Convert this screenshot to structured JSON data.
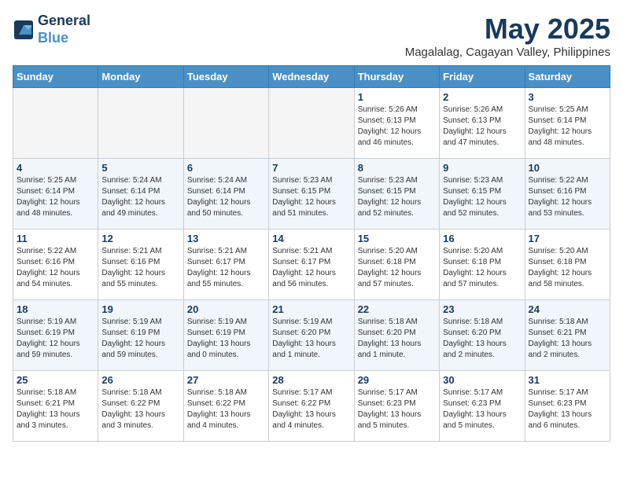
{
  "header": {
    "logo_line1": "General",
    "logo_line2": "Blue",
    "month_title": "May 2025",
    "location": "Magalalag, Cagayan Valley, Philippines"
  },
  "weekdays": [
    "Sunday",
    "Monday",
    "Tuesday",
    "Wednesday",
    "Thursday",
    "Friday",
    "Saturday"
  ],
  "weeks": [
    [
      {
        "day": "",
        "info": ""
      },
      {
        "day": "",
        "info": ""
      },
      {
        "day": "",
        "info": ""
      },
      {
        "day": "",
        "info": ""
      },
      {
        "day": "1",
        "info": "Sunrise: 5:26 AM\nSunset: 6:13 PM\nDaylight: 12 hours\nand 46 minutes."
      },
      {
        "day": "2",
        "info": "Sunrise: 5:26 AM\nSunset: 6:13 PM\nDaylight: 12 hours\nand 47 minutes."
      },
      {
        "day": "3",
        "info": "Sunrise: 5:25 AM\nSunset: 6:14 PM\nDaylight: 12 hours\nand 48 minutes."
      }
    ],
    [
      {
        "day": "4",
        "info": "Sunrise: 5:25 AM\nSunset: 6:14 PM\nDaylight: 12 hours\nand 48 minutes."
      },
      {
        "day": "5",
        "info": "Sunrise: 5:24 AM\nSunset: 6:14 PM\nDaylight: 12 hours\nand 49 minutes."
      },
      {
        "day": "6",
        "info": "Sunrise: 5:24 AM\nSunset: 6:14 PM\nDaylight: 12 hours\nand 50 minutes."
      },
      {
        "day": "7",
        "info": "Sunrise: 5:23 AM\nSunset: 6:15 PM\nDaylight: 12 hours\nand 51 minutes."
      },
      {
        "day": "8",
        "info": "Sunrise: 5:23 AM\nSunset: 6:15 PM\nDaylight: 12 hours\nand 52 minutes."
      },
      {
        "day": "9",
        "info": "Sunrise: 5:23 AM\nSunset: 6:15 PM\nDaylight: 12 hours\nand 52 minutes."
      },
      {
        "day": "10",
        "info": "Sunrise: 5:22 AM\nSunset: 6:16 PM\nDaylight: 12 hours\nand 53 minutes."
      }
    ],
    [
      {
        "day": "11",
        "info": "Sunrise: 5:22 AM\nSunset: 6:16 PM\nDaylight: 12 hours\nand 54 minutes."
      },
      {
        "day": "12",
        "info": "Sunrise: 5:21 AM\nSunset: 6:16 PM\nDaylight: 12 hours\nand 55 minutes."
      },
      {
        "day": "13",
        "info": "Sunrise: 5:21 AM\nSunset: 6:17 PM\nDaylight: 12 hours\nand 55 minutes."
      },
      {
        "day": "14",
        "info": "Sunrise: 5:21 AM\nSunset: 6:17 PM\nDaylight: 12 hours\nand 56 minutes."
      },
      {
        "day": "15",
        "info": "Sunrise: 5:20 AM\nSunset: 6:18 PM\nDaylight: 12 hours\nand 57 minutes."
      },
      {
        "day": "16",
        "info": "Sunrise: 5:20 AM\nSunset: 6:18 PM\nDaylight: 12 hours\nand 57 minutes."
      },
      {
        "day": "17",
        "info": "Sunrise: 5:20 AM\nSunset: 6:18 PM\nDaylight: 12 hours\nand 58 minutes."
      }
    ],
    [
      {
        "day": "18",
        "info": "Sunrise: 5:19 AM\nSunset: 6:19 PM\nDaylight: 12 hours\nand 59 minutes."
      },
      {
        "day": "19",
        "info": "Sunrise: 5:19 AM\nSunset: 6:19 PM\nDaylight: 12 hours\nand 59 minutes."
      },
      {
        "day": "20",
        "info": "Sunrise: 5:19 AM\nSunset: 6:19 PM\nDaylight: 13 hours\nand 0 minutes."
      },
      {
        "day": "21",
        "info": "Sunrise: 5:19 AM\nSunset: 6:20 PM\nDaylight: 13 hours\nand 1 minute."
      },
      {
        "day": "22",
        "info": "Sunrise: 5:18 AM\nSunset: 6:20 PM\nDaylight: 13 hours\nand 1 minute."
      },
      {
        "day": "23",
        "info": "Sunrise: 5:18 AM\nSunset: 6:20 PM\nDaylight: 13 hours\nand 2 minutes."
      },
      {
        "day": "24",
        "info": "Sunrise: 5:18 AM\nSunset: 6:21 PM\nDaylight: 13 hours\nand 2 minutes."
      }
    ],
    [
      {
        "day": "25",
        "info": "Sunrise: 5:18 AM\nSunset: 6:21 PM\nDaylight: 13 hours\nand 3 minutes."
      },
      {
        "day": "26",
        "info": "Sunrise: 5:18 AM\nSunset: 6:22 PM\nDaylight: 13 hours\nand 3 minutes."
      },
      {
        "day": "27",
        "info": "Sunrise: 5:18 AM\nSunset: 6:22 PM\nDaylight: 13 hours\nand 4 minutes."
      },
      {
        "day": "28",
        "info": "Sunrise: 5:17 AM\nSunset: 6:22 PM\nDaylight: 13 hours\nand 4 minutes."
      },
      {
        "day": "29",
        "info": "Sunrise: 5:17 AM\nSunset: 6:23 PM\nDaylight: 13 hours\nand 5 minutes."
      },
      {
        "day": "30",
        "info": "Sunrise: 5:17 AM\nSunset: 6:23 PM\nDaylight: 13 hours\nand 5 minutes."
      },
      {
        "day": "31",
        "info": "Sunrise: 5:17 AM\nSunset: 6:23 PM\nDaylight: 13 hours\nand 6 minutes."
      }
    ]
  ]
}
